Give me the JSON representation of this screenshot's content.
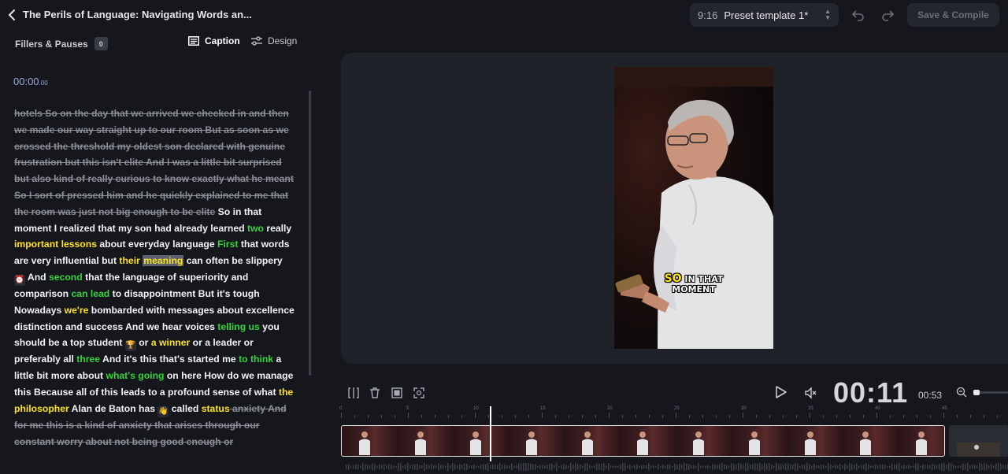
{
  "header": {
    "title": "The Perils of Language: Navigating Words an...",
    "preset": {
      "ratio": "9:16",
      "name": "Preset template 1*"
    },
    "save_label": "Save & Compile"
  },
  "left": {
    "fillers_label": "Fillers & Pauses",
    "fillers_count": "0",
    "tabs": {
      "caption": "Caption",
      "design": "Design"
    },
    "timecode": "00:00",
    "timecode_frac": ".00"
  },
  "transcript": [
    {
      "t": "hotels So on the day that we arrived we checked in and then we made our way straight up to our room But as soon as we crossed the threshold my oldest son declared with genuine frustration but this isn't elite And I was a little bit surprised but also kind of really curious to know exactly what he meant So I sort of pressed him and he quickly explained to me that the room was just not big enough to be elite",
      "s": "del"
    },
    {
      "t": " So in that moment I realized that my son had already learned ",
      "s": ""
    },
    {
      "t": "two",
      "s": "g"
    },
    {
      "t": " really ",
      "s": ""
    },
    {
      "t": "important lessons",
      "s": "y"
    },
    {
      "t": " about everyday language ",
      "s": ""
    },
    {
      "t": "First",
      "s": "g"
    },
    {
      "t": " that words are very influential but ",
      "s": ""
    },
    {
      "t": "their",
      "s": "y"
    },
    {
      "t": " ",
      "s": ""
    },
    {
      "t": "meaning",
      "s": "hl"
    },
    {
      "t": " can often be slippery ",
      "s": ""
    },
    {
      "t": "⏰",
      "s": "emo"
    },
    {
      "t": " And ",
      "s": ""
    },
    {
      "t": "second",
      "s": "g"
    },
    {
      "t": " that the language of superiority and comparison ",
      "s": ""
    },
    {
      "t": "can lead",
      "s": "g"
    },
    {
      "t": " to disappointment But it's tough Nowadays ",
      "s": ""
    },
    {
      "t": "we're",
      "s": "y"
    },
    {
      "t": " bombarded with messages about excellence distinction and success And we hear voices ",
      "s": ""
    },
    {
      "t": "telling us",
      "s": "g"
    },
    {
      "t": " you should be a top student ",
      "s": ""
    },
    {
      "t": "🏆",
      "s": "emo"
    },
    {
      "t": " or ",
      "s": ""
    },
    {
      "t": "a winner",
      "s": "y"
    },
    {
      "t": " or a leader or preferably all ",
      "s": ""
    },
    {
      "t": "three",
      "s": "g"
    },
    {
      "t": " And it's this that's started me ",
      "s": ""
    },
    {
      "t": "to think",
      "s": "g"
    },
    {
      "t": " a little bit more about ",
      "s": ""
    },
    {
      "t": "what's going",
      "s": "g"
    },
    {
      "t": " on here How do we manage this Because all of this leads to a profound sense of what ",
      "s": ""
    },
    {
      "t": "the philosopher",
      "s": "y"
    },
    {
      "t": " Alan de Baton has ",
      "s": ""
    },
    {
      "t": "👋",
      "s": "emo"
    },
    {
      "t": " called ",
      "s": ""
    },
    {
      "t": "status",
      "s": "y"
    },
    {
      "t": " anxiety And for me this is a kind of anxiety that arises through our constant worry about not being good enough or",
      "s": "del"
    }
  ],
  "video": {
    "caption_line1_big": "SO",
    "caption_line1": " IN THAT",
    "caption_line2": "MOMENT"
  },
  "playback": {
    "current": "00:11",
    "total": "00:53"
  },
  "timeline": {
    "ruler_labels": [
      "0",
      "5",
      "10",
      "15",
      "20",
      "25",
      "30",
      "35",
      "40",
      "45",
      "50"
    ]
  },
  "colors": {
    "highlight_green": "#34d43a",
    "highlight_yellow": "#ffe21a",
    "background": "#15171d"
  }
}
